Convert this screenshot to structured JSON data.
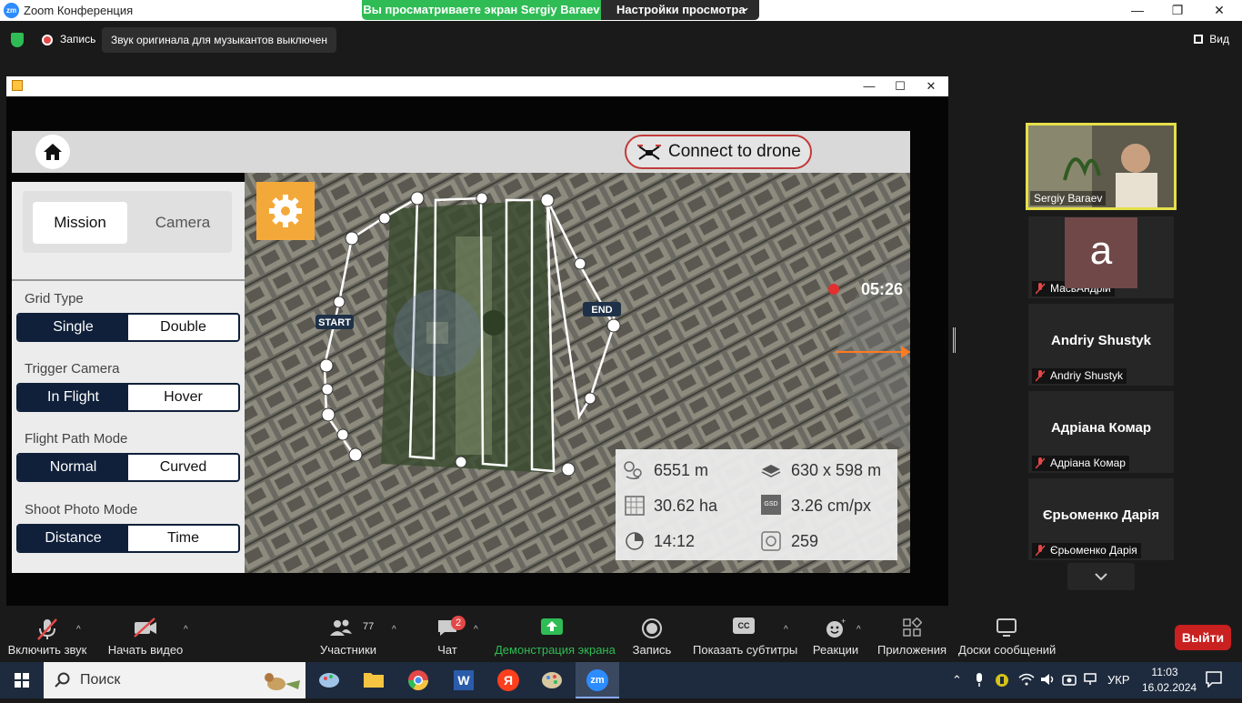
{
  "window": {
    "title": "Zoom Конференция",
    "minimize": "—",
    "maximize": "❐",
    "close": "✕"
  },
  "share_banner": {
    "viewing": "Вы просматриваете экран Sergiy Baraev",
    "view_settings": "Настройки просмотра",
    "caret": "⌄"
  },
  "info_row": {
    "recording": "Запись",
    "sound_notice": "Звук оригинала для музыкантов выключен",
    "view": "Вид"
  },
  "shared_window": {
    "minimize": "—",
    "maximize": "☐",
    "close": "✕"
  },
  "app": {
    "connect_button": "Connect to drone",
    "tabs": {
      "mission": "Mission",
      "camera": "Camera"
    },
    "groups": [
      {
        "label": "Grid Type",
        "options": [
          "Single",
          "Double"
        ],
        "selected": 0
      },
      {
        "label": "Trigger Camera",
        "options": [
          "In Flight",
          "Hover"
        ],
        "selected": 0
      },
      {
        "label": "Flight Path Mode",
        "options": [
          "Normal",
          "Curved"
        ],
        "selected": 0
      },
      {
        "label": "Shoot Photo Mode",
        "options": [
          "Distance",
          "Time"
        ],
        "selected": 0
      }
    ],
    "map": {
      "start_label": "START",
      "end_label": "END",
      "timer": "05:26"
    },
    "stats": {
      "distance": "6551 m",
      "dimensions": "630 x 598 m",
      "area": "30.62 ha",
      "gsd": "3.26 cm/px",
      "gsd_icon_text": "GSD",
      "time": "14:12",
      "photos": "259"
    }
  },
  "participants": [
    {
      "name": "Sergiy Baraev",
      "video": true
    },
    {
      "avatar_letter": "a",
      "name": "МасьАндрій",
      "muted": true
    },
    {
      "display": "Andriy Shustyk",
      "name": "Andriy Shustyk",
      "muted": true
    },
    {
      "display": "Адріана Комар",
      "name": "Адріана Комар",
      "muted": true
    },
    {
      "display": "Єрьоменко Дарія",
      "name": "Єрьоменко Дарія",
      "muted": true
    }
  ],
  "toolbar": {
    "unmute": "Включить звук",
    "start_video": "Начать видео",
    "participants": "Участники",
    "participants_count": "77",
    "chat": "Чат",
    "chat_badge": "2",
    "share_screen": "Демонстрация экрана",
    "record": "Запись",
    "captions": "Показать субтитры",
    "captions_icon": "CC",
    "reactions": "Реакции",
    "apps": "Приложения",
    "whiteboards": "Доски сообщений",
    "leave": "Выйти",
    "caret": "^"
  },
  "taskbar": {
    "search": "Поиск",
    "language": "УКР",
    "time": "11:03",
    "date": "16.02.2024",
    "word_letter": "W",
    "yandex_letter": "Я",
    "zoom_letter": "zm"
  },
  "colors": {
    "zoom_green": "#2fbc55",
    "zoom_red": "#c92020",
    "navy": "#10203a",
    "orange": "#f3a93a",
    "active_speaker": "#e4e04a"
  }
}
